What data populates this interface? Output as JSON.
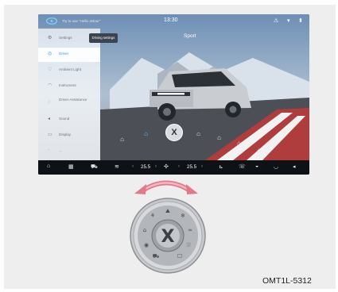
{
  "status_bar": {
    "hint": "Try to use \"Hello Jetour\"",
    "time": "13:30",
    "icons": [
      "warning-icon",
      "wifi-icon",
      "signal-icon"
    ]
  },
  "sidebar": {
    "items": [
      {
        "label": "Settings",
        "icon": "gear-icon",
        "active": false
      },
      {
        "label": "Driver",
        "icon": "steering-wheel-icon",
        "active": true
      },
      {
        "label": "Ambient Light",
        "icon": "bulb-icon",
        "active": false
      },
      {
        "label": "Instrument",
        "icon": "gauge-icon",
        "active": false
      },
      {
        "label": "Driver Assistance",
        "icon": "assist-icon",
        "active": false
      },
      {
        "label": "Sound",
        "icon": "speaker-icon",
        "active": false
      },
      {
        "label": "Display",
        "icon": "display-icon",
        "active": false
      },
      {
        "label": "...",
        "icon": "more-icon",
        "active": false
      }
    ]
  },
  "tooltip": "Driving settings",
  "mode": "Sport",
  "center_button": "X",
  "drive_mode_icons": [
    "mode-1-icon",
    "mode-2-icon",
    "mode-3-icon",
    "mode-4-icon",
    "mode-5-icon",
    "mode-6-icon",
    "mode-7-icon"
  ],
  "bottom_bar": {
    "left_temp": "25.5",
    "right_temp": "25.5",
    "icons": [
      "home-icon",
      "apps-icon",
      "car-icon",
      "seat-heat-icon",
      "fan-icon",
      "seat-icon",
      "phone-icon",
      "recirculation-icon",
      "defrost-icon",
      "volume-icon"
    ]
  },
  "knob": {
    "center": "X"
  },
  "colors": {
    "accent": "#2f9bd6",
    "bar": "#0e1216",
    "arrow": "#e07a88"
  },
  "caption": "OMT1L-5312"
}
